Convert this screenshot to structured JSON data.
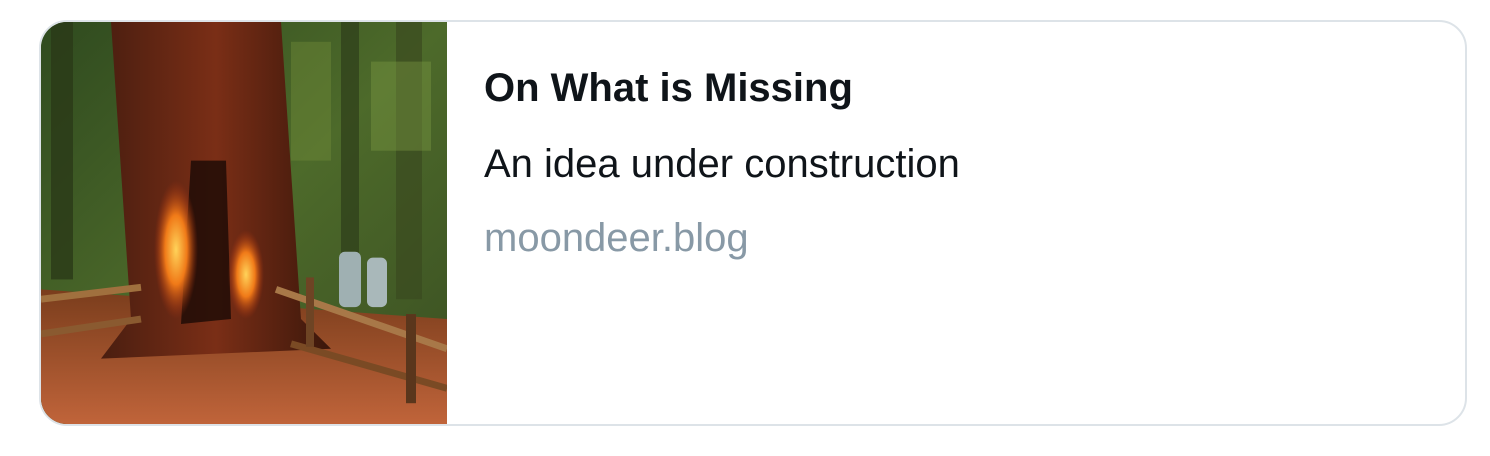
{
  "card": {
    "image": {
      "alt": "Painting of a fire-scarred redwood trunk in a forest with a wooden fence and gravestones",
      "icon": "thumbnail-image"
    },
    "title": "On What is Missing",
    "description": "An idea under construction",
    "domain": "moondeer.blog"
  },
  "colors": {
    "border": "#dde3e8",
    "title_text": "#0f1419",
    "domain_text": "#8899a6"
  }
}
